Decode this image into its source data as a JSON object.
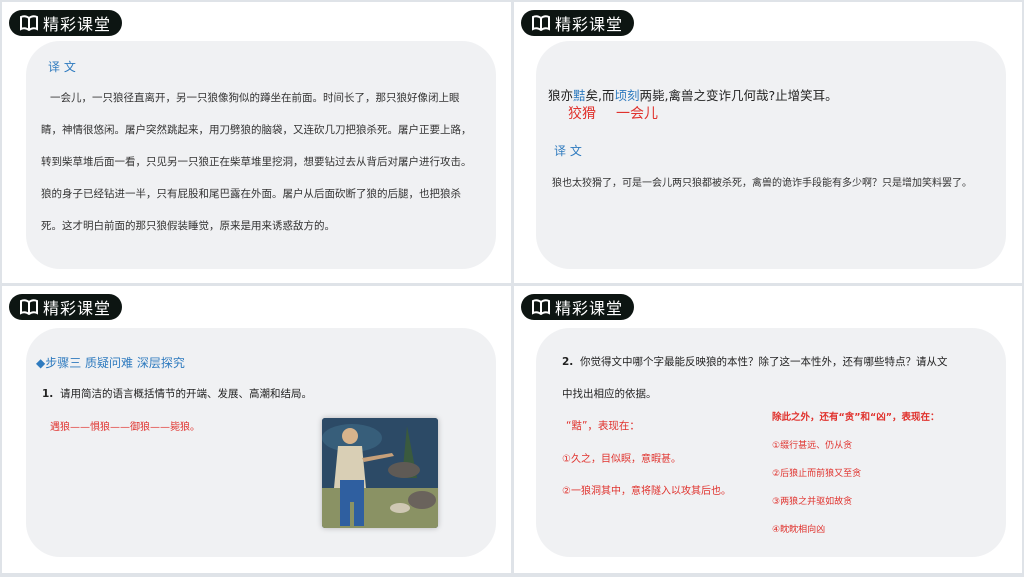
{
  "header_title": "精彩课堂",
  "slide1": {
    "section_label": "译 文",
    "lines": [
      "一会儿，一只狼径直离开，另一只狼像狗似的蹲坐在前面。时间长了，那只狼好像闭上眼",
      "睛，神情很悠闲。屠户突然跳起来，用刀劈狼的脑袋，又连砍几刀把狼杀死。屠户正要上路，",
      "转到柴草堆后面一看，只见另一只狼正在柴草堆里挖洞，想要钻过去从背后对屠户进行攻击。",
      "狼的身子已经钻进一半，只有屁股和尾巴露在外面。屠户从后面砍断了狼的后腿，也把狼杀",
      "死。这才明白前面的那只狼假装睡觉，原来是用来诱惑敌方的。"
    ]
  },
  "slide2": {
    "sentence_a": "狼亦",
    "sentence_word1": "黠",
    "sentence_b": "矣,而",
    "sentence_word2": "顷刻",
    "sentence_c": "两毙,禽兽之变诈几何哉?止增笑耳。",
    "gloss1": "狡猾",
    "gloss2": "一会儿",
    "section_label": "译 文",
    "translation": "狼也太狡猾了，可是一会儿两只狼都被杀死，禽兽的诡诈手段能有多少啊？只是增加笑料罢了。"
  },
  "slide3": {
    "step_title": "◆步骤三  质疑问难  深层探究",
    "question_num": "1.",
    "question_text": "请用简洁的语言概括情节的开端、发展、高潮和结局。",
    "answer": "遇狼——惧狼——御狼——毙狼。"
  },
  "slide4": {
    "question_num": "2.",
    "question_line1": "你觉得文中哪个字最能反映狼的本性？除了这一本性外，还有哪些特点？请从文",
    "question_line2": "中找出相应的依据。",
    "left_title": "“黠”，表现在：",
    "left_items": [
      "①久之，目似瞑，意暇甚。",
      "②一狼洞其中，意将隧入以攻其后也。"
    ],
    "right_title": "除此之外，还有“贪”和“凶”，表现在：",
    "right_items": [
      "①缀行甚远、仍从贪",
      "②后狼止而前狼又至贪",
      "③两狼之并驱如故贪",
      "④眈眈相向凶"
    ]
  },
  "colors": {
    "accent_blue": "#2f7bbf",
    "accent_red": "#e0322d",
    "header_bg": "#0d1512"
  },
  "icons": {
    "header": "open-book-icon"
  }
}
